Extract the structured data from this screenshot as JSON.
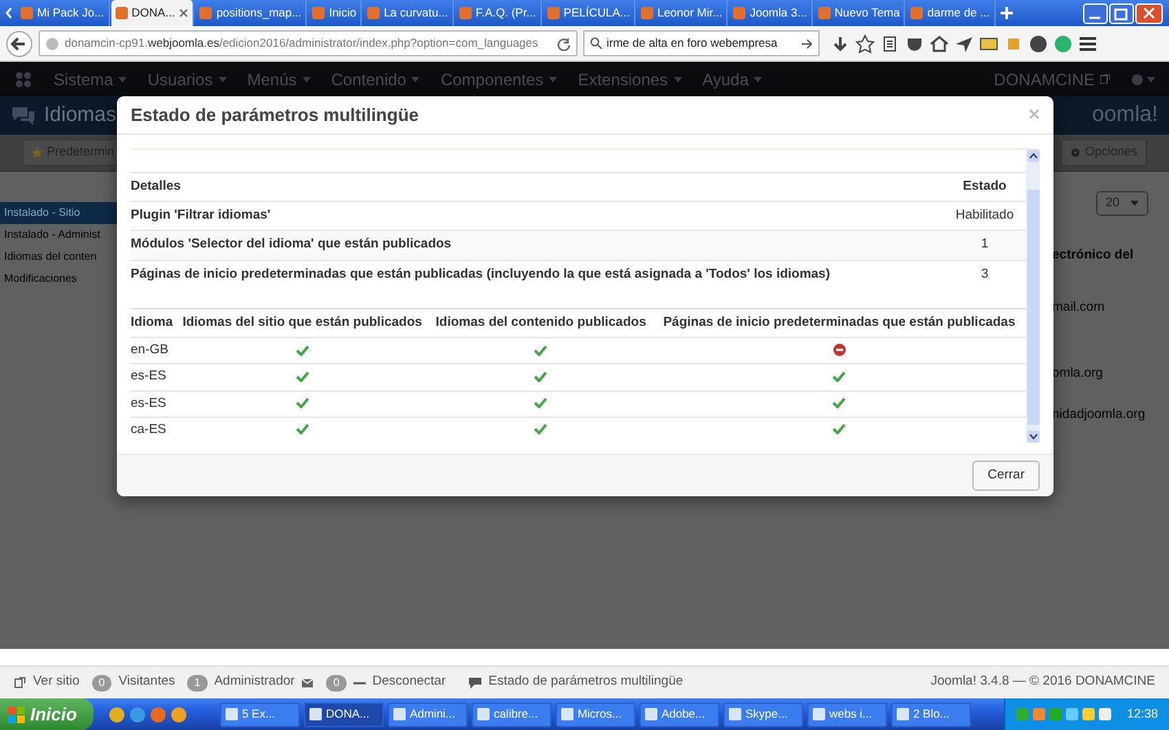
{
  "browser": {
    "tabs": [
      {
        "label": "Mi Pack Jo...",
        "selected": false
      },
      {
        "label": "DONA...",
        "selected": true
      },
      {
        "label": "positions_map...",
        "selected": false
      },
      {
        "label": "Inicio",
        "selected": false
      },
      {
        "label": "La curvatu...",
        "selected": false
      },
      {
        "label": "F.A.Q. (Pr...",
        "selected": false
      },
      {
        "label": "PELÍCULA...",
        "selected": false
      },
      {
        "label": "Leonor Mir...",
        "selected": false
      },
      {
        "label": "Joomla 3...",
        "selected": false
      },
      {
        "label": "Nuevo Tema",
        "selected": false
      },
      {
        "label": "darme de ...",
        "selected": false
      }
    ],
    "url": "donamcin-cp91.**webjoomla.es**/edicion2016/administrator/index.php?option=com_languages",
    "search": {
      "value": "irme de alta en foro webempresa"
    }
  },
  "admin": {
    "menu": [
      "Sistema",
      "Usuarios",
      "Menús",
      "Contenido",
      "Componentes",
      "Extensiones",
      "Ayuda"
    ],
    "user": "DONAMCINE",
    "page_title": "Idiomas",
    "logo": "oomla!",
    "toolbar": [
      {
        "label": "Predetermin",
        "kind": "star"
      },
      {
        "label": "Opciones",
        "kind": "gear"
      }
    ],
    "sidebar": [
      {
        "label": "Instalado - Sitio",
        "selected": true
      },
      {
        "label": "Instalado - Administ",
        "selected": false
      },
      {
        "label": "Idiomas del conten",
        "selected": false
      },
      {
        "label": "Modificaciones",
        "selected": false
      }
    ],
    "limit": "20",
    "column_fragments": [
      "ectrónico del",
      "mail.com",
      "omla.org",
      "nidadjoomla.org"
    ]
  },
  "modal": {
    "title": "Estado de parámetros multilingüe",
    "details": {
      "columns": [
        "Detalles",
        "Estado"
      ],
      "rows": [
        {
          "detail": "Plugin 'Filtrar idiomas'",
          "status": "Habilitado"
        },
        {
          "detail": "Módulos 'Selector del idioma' que están publicados",
          "status": "1"
        },
        {
          "detail": "Páginas de inicio predeterminadas que están publicadas (incluyendo la que está asignada a 'Todos' los idiomas)",
          "status": "3"
        }
      ]
    },
    "languages": {
      "columns": [
        "Idioma",
        "Idiomas del sitio que están publicados",
        "Idiomas del contenido publicados",
        "Páginas de inicio predeterminadas que están publicadas"
      ],
      "rows": [
        {
          "language": "en-GB",
          "site_published": true,
          "content_published": true,
          "home_published": false
        },
        {
          "language": "es-ES",
          "site_published": true,
          "content_published": true,
          "home_published": true
        },
        {
          "language": "es-ES",
          "site_published": true,
          "content_published": true,
          "home_published": true
        },
        {
          "language": "ca-ES",
          "site_published": true,
          "content_published": true,
          "home_published": true
        }
      ]
    },
    "close_button": "Cerrar"
  },
  "status_bar": {
    "view_site": "Ver sitio",
    "visitors": {
      "count": "0",
      "label": "Visitantes"
    },
    "admins": {
      "count": "1",
      "label": "Administrador"
    },
    "messages": {
      "count": "0"
    },
    "logout": "Desconectar",
    "multilingual_status": "Estado de parámetros multilingüe",
    "version": "Joomla! 3.4.8 — © 2016 DONAMCINE"
  },
  "taskbar": {
    "start": "Inicio",
    "tasks": [
      {
        "label": "5 Ex...",
        "selected": false
      },
      {
        "label": "DONA...",
        "selected": true
      },
      {
        "label": "Admini...",
        "selected": false
      },
      {
        "label": "calibre...",
        "selected": false
      },
      {
        "label": "Micros...",
        "selected": false
      },
      {
        "label": "Adobe...",
        "selected": false
      },
      {
        "label": "Skype...",
        "selected": false
      },
      {
        "label": "webs i...",
        "selected": false
      },
      {
        "label": "2 Blo...",
        "selected": false
      }
    ],
    "clock": "12:38"
  }
}
